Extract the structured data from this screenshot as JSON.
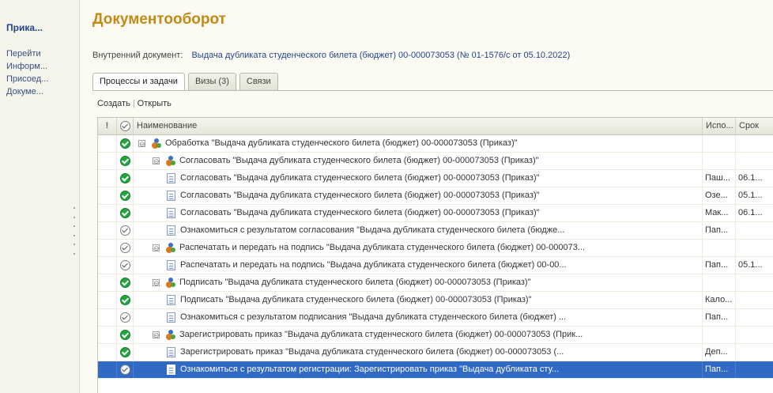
{
  "left_nav": {
    "title": "Прика...",
    "items": [
      "Перейти",
      "Информ...",
      "Присоед...",
      "Докуме..."
    ]
  },
  "header": {
    "title": "Документооборот",
    "doc_label": "Внутренний документ:",
    "doc_link": "Выдача дубликата студенческого билета (бюджет) 00-000073053 (№ 01-1576/с от 05.10.2022)"
  },
  "tabs": [
    "Процессы и задачи",
    "Визы (3)",
    "Связи"
  ],
  "commands": {
    "create": "Создать",
    "separator": "|",
    "open": "Открыть"
  },
  "table": {
    "columns": {
      "importance": "!",
      "name": "Наименование",
      "executor": "Испо...",
      "due": "Срок"
    },
    "rows": [
      {
        "status": "done",
        "level": 0,
        "kind": "process",
        "toggle": "⊖",
        "name": "Обработка \"Выдача дубликата студенческого билета (бюджет) 00-000073053 (Приказ)\"",
        "executor": "",
        "due": ""
      },
      {
        "status": "done",
        "level": 1,
        "kind": "process",
        "toggle": "⊖",
        "name": "Согласовать \"Выдача дубликата студенческого билета (бюджет) 00-000073053 (Приказ)\"",
        "executor": "",
        "due": ""
      },
      {
        "status": "done",
        "level": 2,
        "kind": "task",
        "toggle": "",
        "name": "Согласовать \"Выдача дубликата студенческого билета (бюджет) 00-000073053 (Приказ)\"",
        "executor": "Паш...",
        "due": "06.1..."
      },
      {
        "status": "done",
        "level": 2,
        "kind": "task",
        "toggle": "",
        "name": "Согласовать \"Выдача дубликата студенческого билета (бюджет) 00-000073053 (Приказ)\"",
        "executor": "Озе...",
        "due": "05.1..."
      },
      {
        "status": "done",
        "level": 2,
        "kind": "task",
        "toggle": "",
        "name": "Согласовать \"Выдача дубликата студенческого билета (бюджет) 00-000073053 (Приказ)\"",
        "executor": "Мак...",
        "due": "06.1..."
      },
      {
        "status": "pending",
        "level": 2,
        "kind": "task",
        "toggle": "",
        "name": "Ознакомиться с результатом согласования \"Выдача дубликата студенческого билета (бюдже...",
        "executor": "Пап...",
        "due": ""
      },
      {
        "status": "pending",
        "level": 1,
        "kind": "process",
        "toggle": "⊖",
        "name": "Распечатать и передать на подпись \"Выдача дубликата студенческого билета (бюджет) 00-000073...",
        "executor": "",
        "due": ""
      },
      {
        "status": "pending",
        "level": 2,
        "kind": "task",
        "toggle": "",
        "name": "Распечатать и передать на подпись \"Выдача дубликата студенческого билета (бюджет) 00-00...",
        "executor": "Пап...",
        "due": "05.1..."
      },
      {
        "status": "done",
        "level": 1,
        "kind": "process",
        "toggle": "⊖",
        "name": "Подписать \"Выдача дубликата студенческого билета (бюджет) 00-000073053 (Приказ)\"",
        "executor": "",
        "due": ""
      },
      {
        "status": "done",
        "level": 2,
        "kind": "task",
        "toggle": "",
        "name": "Подписать \"Выдача дубликата студенческого билета (бюджет) 00-000073053 (Приказ)\"",
        "executor": "Кало...",
        "due": ""
      },
      {
        "status": "pending",
        "level": 2,
        "kind": "task",
        "toggle": "",
        "name": "Ознакомиться с результатом подписания \"Выдача дубликата студенческого билета (бюджет) ...",
        "executor": "Пап...",
        "due": ""
      },
      {
        "status": "done",
        "level": 1,
        "kind": "process",
        "toggle": "⊖",
        "name": "Зарегистрировать приказ \"Выдача дубликата студенческого билета (бюджет) 00-000073053 (Прик...",
        "executor": "",
        "due": ""
      },
      {
        "status": "done",
        "level": 2,
        "kind": "task",
        "toggle": "",
        "name": "Зарегистрировать приказ \"Выдача дубликата студенческого билета (бюджет) 00-000073053 (...",
        "executor": "Деп...",
        "due": ""
      },
      {
        "status": "pending",
        "level": 2,
        "kind": "task",
        "toggle": "",
        "name": "Ознакомиться с результатом регистрации: Зарегистрировать приказ \"Выдача дубликата сту...",
        "executor": "Пап...",
        "due": "",
        "selected": true
      }
    ]
  },
  "colors": {
    "title": "#c28a12",
    "link": "#24448b",
    "selection": "#316ac5",
    "done": "#21a63b"
  }
}
